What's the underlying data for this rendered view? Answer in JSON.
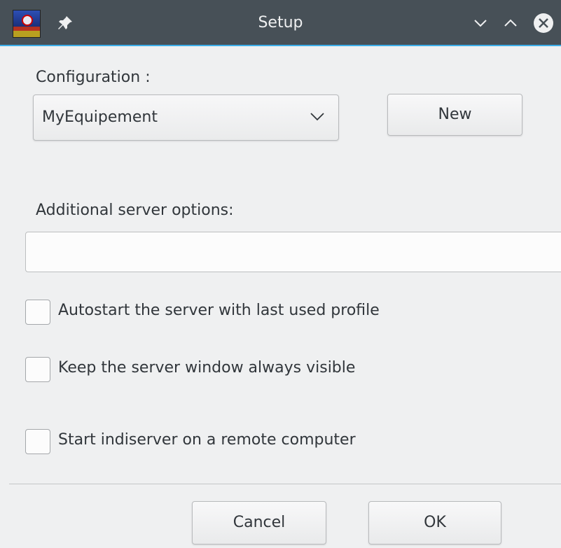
{
  "window": {
    "title": "Setup",
    "accent_color": "#3daee9",
    "titlebar_color": "#475057"
  },
  "titlebar": {
    "icons": [
      "app-icon",
      "pin-icon",
      "minimize-icon",
      "maximize-icon",
      "close-icon"
    ]
  },
  "configuration": {
    "label": "Configuration :",
    "selected": "MyEquipement",
    "new_button": "New"
  },
  "server_options": {
    "label": "Additional server options:",
    "value": "",
    "placeholder": ""
  },
  "checkboxes": [
    {
      "label": "Autostart the server with last used profile",
      "checked": false
    },
    {
      "label": "Keep the server window always visible",
      "checked": false
    },
    {
      "label": "Start indiserver on a remote computer",
      "checked": false
    }
  ],
  "footer": {
    "cancel_label": "Cancel",
    "ok_label": "OK"
  }
}
